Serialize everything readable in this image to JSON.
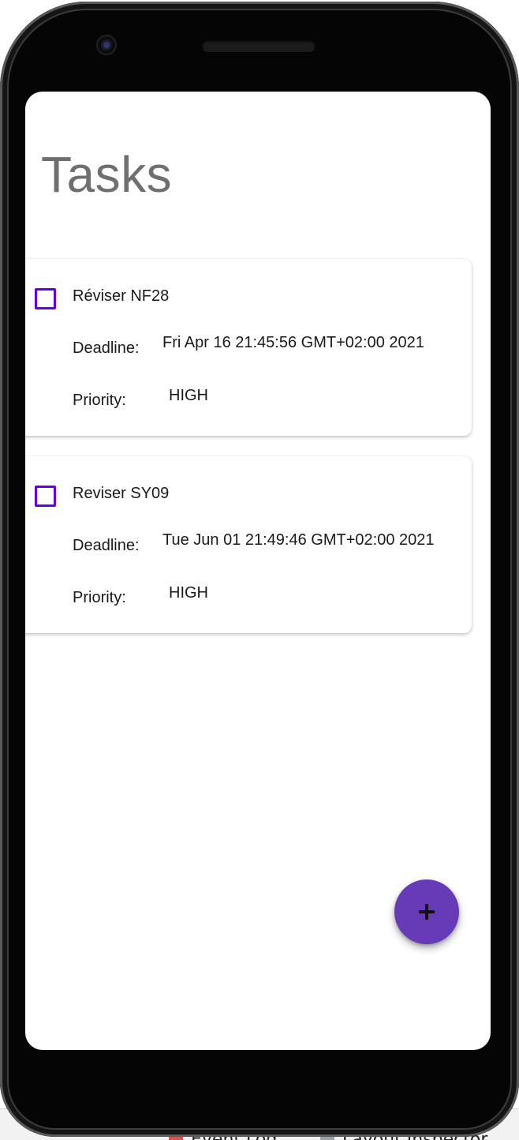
{
  "ide": {
    "tabs": [
      {
        "label": "Event Log"
      },
      {
        "label": "Layout Inspector"
      }
    ]
  },
  "app": {
    "title": "Tasks",
    "labels": {
      "deadline": "Deadline:",
      "priority": "Priority:"
    },
    "tasks": [
      {
        "name": "Réviser NF28",
        "checked": false,
        "deadline": "Fri Apr 16 21:45:56 GMT+02:00 2021",
        "priority": "HIGH"
      },
      {
        "name": "Reviser SY09",
        "checked": false,
        "deadline": "Tue Jun 01 21:49:46 GMT+02:00 2021",
        "priority": "HIGH"
      }
    ],
    "fab": {
      "icon": "plus-icon",
      "label": "+"
    }
  },
  "colors": {
    "checkbox_border": "#6200ee",
    "fab_background": "#673ab7",
    "title_text": "#6f6f6f"
  }
}
